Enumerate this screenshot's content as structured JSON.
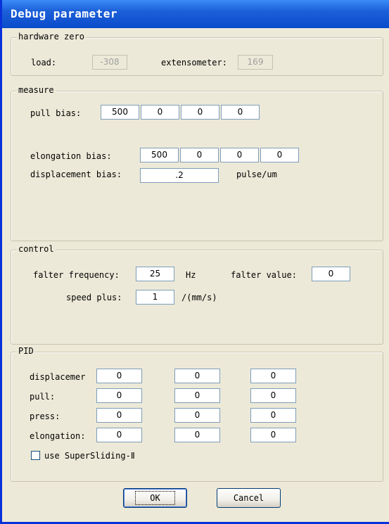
{
  "window": {
    "title": "Debug parameter"
  },
  "hardware_zero": {
    "legend": "hardware zero",
    "load_label": "load:",
    "load_value": "-308",
    "extensometer_label": "extensometer:",
    "extensometer_value": "169"
  },
  "measure": {
    "legend": "measure",
    "pull_bias_label": "pull bias:",
    "pull_bias_values": [
      "500",
      "0",
      "0",
      "0"
    ],
    "elongation_bias_label": "elongation bias:",
    "elongation_bias_values": [
      "500",
      "0",
      "0",
      "0"
    ],
    "displacement_bias_label": "displacement bias:",
    "displacement_bias_value": ".2",
    "displacement_bias_unit": "pulse/um"
  },
  "control": {
    "legend": "control",
    "falter_frequency_label": "falter frequency:",
    "falter_frequency_value": "25",
    "falter_frequency_unit": "Hz",
    "falter_value_label": "falter value:",
    "falter_value_value": "0",
    "speed_plus_label": "speed plus:",
    "speed_plus_value": "1",
    "speed_plus_unit": "/(mm/s)"
  },
  "pid": {
    "legend": "PID",
    "rows": [
      {
        "label": "displacemer",
        "values": [
          "0",
          "0",
          "0"
        ]
      },
      {
        "label": "pull:",
        "values": [
          "0",
          "0",
          "0"
        ]
      },
      {
        "label": "press:",
        "values": [
          "0",
          "0",
          "0"
        ]
      },
      {
        "label": "elongation:",
        "values": [
          "0",
          "0",
          "0"
        ]
      }
    ],
    "supersliding_label": "use SuperSliding-Ⅱ",
    "supersliding_checked": false
  },
  "buttons": {
    "ok": "OK",
    "cancel": "Cancel"
  }
}
